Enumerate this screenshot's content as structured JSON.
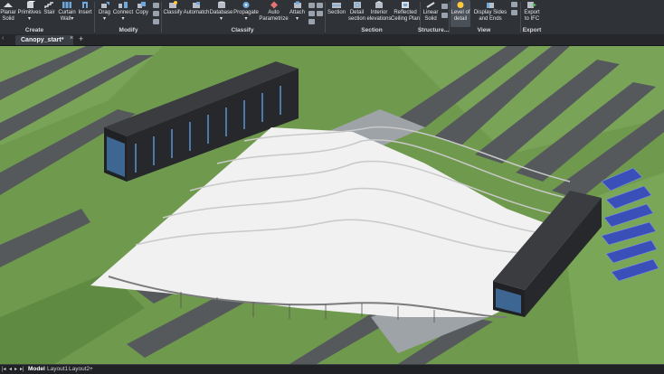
{
  "ribbon": {
    "tools": [
      {
        "id": "planar-solid",
        "label": "Planar\nSolid",
        "icon": "planar-solid-icon"
      },
      {
        "id": "primitives",
        "label": "Primitives\n▾",
        "icon": "primitives-icon"
      },
      {
        "id": "stair",
        "label": "Stair",
        "icon": "stair-icon"
      },
      {
        "id": "curtain-wall",
        "label": "Curtain\nWall▾",
        "icon": "curtain-wall-icon"
      },
      {
        "id": "insert",
        "label": "Insert",
        "icon": "insert-icon"
      },
      {
        "id": "drag",
        "label": "Drag\n▾",
        "icon": "drag-icon"
      },
      {
        "id": "connect",
        "label": "Connect\n▾",
        "icon": "connect-icon"
      },
      {
        "id": "copy",
        "label": "Copy",
        "icon": "copy-icon"
      },
      {
        "id": "classify",
        "label": "Classify",
        "icon": "classify-icon"
      },
      {
        "id": "automatch",
        "label": "Automatch",
        "icon": "automatch-icon"
      },
      {
        "id": "database",
        "label": "Database\n▾",
        "icon": "database-icon"
      },
      {
        "id": "propagate",
        "label": "Propagate\n▾",
        "icon": "propagate-icon"
      },
      {
        "id": "auto-parametrize",
        "label": "Auto\nParametrize",
        "icon": "auto-parametrize-icon"
      },
      {
        "id": "attach",
        "label": "Attach\n▾",
        "icon": "attach-icon"
      },
      {
        "id": "section",
        "label": "Section",
        "icon": "section-icon"
      },
      {
        "id": "detail-section",
        "label": "Detail\nsection",
        "icon": "detail-section-icon"
      },
      {
        "id": "interior-elevations",
        "label": "Interior\nelevations",
        "icon": "interior-elevations-icon"
      },
      {
        "id": "reflected-ceiling-plan",
        "label": "Reflected\nCeiling Plan",
        "icon": "reflected-ceiling-plan-icon"
      },
      {
        "id": "linear-solid",
        "label": "Linear\nSolid",
        "icon": "linear-solid-icon"
      },
      {
        "id": "level-of-detail",
        "label": "Level of\ndetail",
        "icon": "level-of-detail-icon"
      },
      {
        "id": "display-sides-and-ends",
        "label": "Display Sides\nand Ends",
        "icon": "display-sides-and-ends-icon"
      },
      {
        "id": "export-to-ifc",
        "label": "Export\nto IFC",
        "icon": "export-to-ifc-icon"
      }
    ],
    "groups": {
      "create": "Create",
      "modify": "Modify",
      "classify": "Classify",
      "section": "Section",
      "structure": "Structure...",
      "view": "View",
      "export": "Export"
    },
    "colors": {
      "accent": "#ffc83d",
      "icon_blue": "#6fa8dc",
      "icon_gray": "#b7bec7"
    }
  },
  "tabs": {
    "active": "Canopy_start*",
    "close": "×",
    "add": "+",
    "prev": "‹"
  },
  "viewport": {
    "colors": {
      "grass": "#6f9a4e",
      "grass_light": "#7aa657",
      "road": "#56595c",
      "building_dark": "#2a2c30",
      "canopy": "#f1f1f1",
      "solar": "#3a4fb8"
    }
  },
  "statusbar": {
    "nav": [
      "|◂",
      "◂",
      "▸",
      "▸|"
    ],
    "layouts": [
      "Model",
      "Layout1",
      "Layout2"
    ],
    "add": "+"
  }
}
